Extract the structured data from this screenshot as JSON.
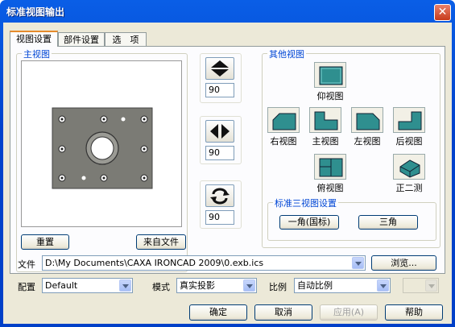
{
  "window": {
    "title": "标准视图输出",
    "close_glyph": "✕"
  },
  "tabs": [
    "视图设置",
    "部件设置",
    "选　项"
  ],
  "main_view": {
    "label": "主视图",
    "reset_label": "重置",
    "from_file_label": "来自文件"
  },
  "rotation": {
    "vertical_value": "90",
    "horizontal_value": "90",
    "spin_value": "90"
  },
  "other_views": {
    "label": "其他视图",
    "bottom_view": "仰视图",
    "right_view": "右视图",
    "front_view": "主视图",
    "left_view": "左视图",
    "back_view": "后视图",
    "top_view": "俯视图",
    "dimetric_view": "正二测"
  },
  "standard_three_views": {
    "label": "标准三视图设置",
    "first_angle": "一角(国标)",
    "third_angle": "三角"
  },
  "file": {
    "label": "文件",
    "value": "D:\\My Documents\\CAXA IRONCAD 2009\\0.exb.ics",
    "browse_label": "浏览..."
  },
  "config": {
    "label": "配置",
    "value": "Default"
  },
  "mode": {
    "label": "模式",
    "value": "真实投影"
  },
  "scale": {
    "label": "比例",
    "value": "自动比例",
    "extra_value": ""
  },
  "buttons": {
    "ok": "确定",
    "cancel": "取消",
    "apply": "应用(A)",
    "help": "帮助"
  },
  "colors": {
    "title_blue": "#0050d8",
    "group_label": "#0046d5",
    "part_gray": "#7b7b75",
    "face_teal": "#2f8f8f"
  }
}
